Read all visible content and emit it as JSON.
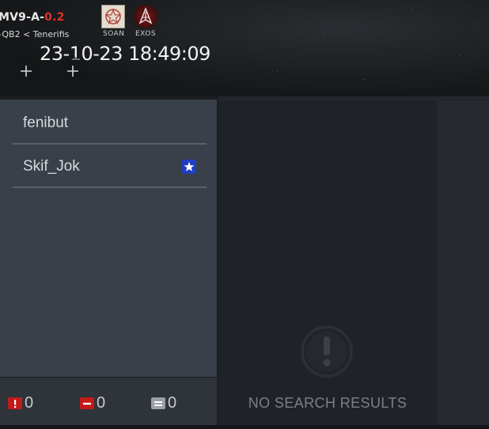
{
  "header": {
    "system_name": "MV9-A-",
    "security_status": "0.2",
    "constellation_path": "-QB2 < Tenerifis",
    "datetime": "23-10-23 18:49:09",
    "corps": [
      {
        "ticker": "SOAN",
        "icon": "pentagram-emblem-icon"
      },
      {
        "ticker": "EXOS",
        "icon": "spire-emblem-icon"
      }
    ],
    "add_buttons": [
      "plus-icon",
      "plus-icon"
    ]
  },
  "members": [
    {
      "name": "fenibut",
      "standing": null
    },
    {
      "name": "Skif_Jok",
      "standing": "blue-star-icon"
    }
  ],
  "counters": [
    {
      "icon": "exclamation-red-icon",
      "value": "0"
    },
    {
      "icon": "minus-red-icon",
      "value": "0"
    },
    {
      "icon": "equals-grey-icon",
      "value": "0"
    }
  ],
  "search_results": {
    "empty_icon": "exclamation-circle-icon",
    "empty_text": "NO SEARCH RESULTS"
  },
  "colors": {
    "security_low": "#e0332a",
    "standing_blue": "#1f3fc2",
    "alert_red": "#c41a1a"
  }
}
